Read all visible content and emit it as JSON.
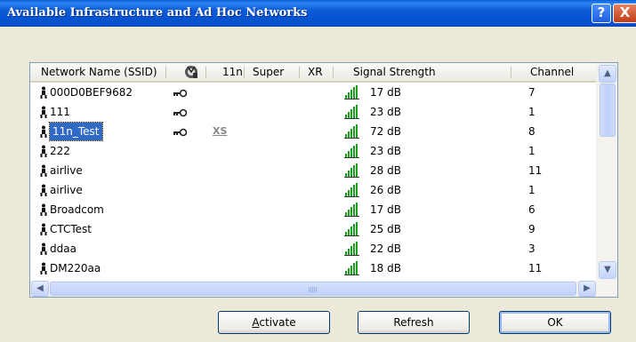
{
  "window": {
    "title": "Available Infrastructure and Ad Hoc Networks",
    "help_label": "?",
    "close_label": "X"
  },
  "columns": {
    "ssid": "Network Name (SSID)",
    "n11": "11n",
    "super": "Super",
    "xr": "XR",
    "signal": "Signal Strength",
    "channel": "Channel"
  },
  "networks": [
    {
      "ssid": "000D0BEF9682",
      "secured": true,
      "xs": false,
      "signal": "17 dB",
      "channel": "7"
    },
    {
      "ssid": "111",
      "secured": true,
      "xs": false,
      "signal": "23 dB",
      "channel": "1"
    },
    {
      "ssid": "11n_Test",
      "secured": true,
      "xs": true,
      "signal": "72 dB",
      "channel": "8",
      "selected": true
    },
    {
      "ssid": "222",
      "secured": false,
      "xs": false,
      "signal": "23 dB",
      "channel": "1"
    },
    {
      "ssid": "airlive",
      "secured": false,
      "xs": false,
      "signal": "28 dB",
      "channel": "11"
    },
    {
      "ssid": "airlive",
      "secured": false,
      "xs": false,
      "signal": "26 dB",
      "channel": "1"
    },
    {
      "ssid": "Broadcom",
      "secured": false,
      "xs": false,
      "signal": "17 dB",
      "channel": "6"
    },
    {
      "ssid": "CTCTest",
      "secured": false,
      "xs": false,
      "signal": "25 dB",
      "channel": "9"
    },
    {
      "ssid": "ddaa",
      "secured": false,
      "xs": false,
      "signal": "22 dB",
      "channel": "3"
    },
    {
      "ssid": "DM220aa",
      "secured": false,
      "xs": false,
      "signal": "18 dB",
      "channel": "11"
    }
  ],
  "xs_label": "XS",
  "buttons": {
    "activate_u": "A",
    "activate_rest": "ctivate",
    "refresh": "Refresh",
    "ok": "OK"
  },
  "colors": {
    "titlebar": "#0454d2",
    "selection": "#316ac5",
    "signal_bars": "#1b9e1b"
  },
  "icons": {
    "adhoc": "person-icon",
    "security": "key-icon",
    "signal": "signal-bars-icon",
    "super_header": "wireless-badge-icon"
  }
}
